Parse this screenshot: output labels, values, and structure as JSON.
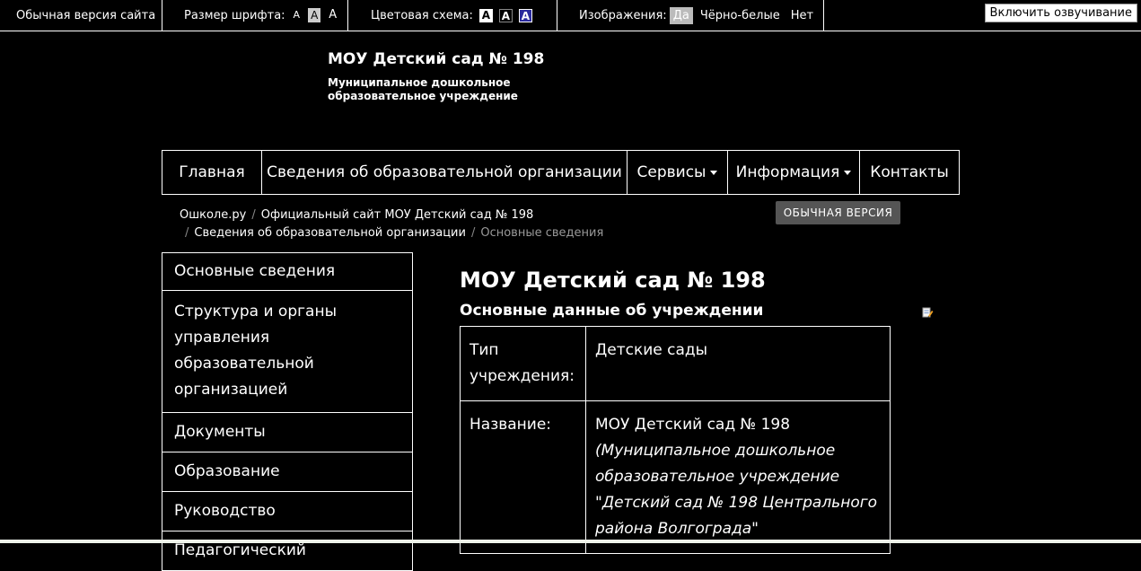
{
  "a11y": {
    "normal_version": "Обычная версия сайта",
    "font_size_label": "Размер шрифта:",
    "font_sizes": [
      "A",
      "A",
      "A"
    ],
    "color_scheme_label": "Цветовая схема:",
    "color_schemes": [
      "A",
      "A",
      "A"
    ],
    "images_label": "Изображения:",
    "images_on": "Да",
    "images_bw": "Чёрно-белые",
    "images_off": "Нет",
    "voice_button": "Включить озвучивание"
  },
  "header": {
    "title": "МОУ Детский сад № 198",
    "subtitle": "Муниципальное дошкольное образовательное учреждение"
  },
  "nav": {
    "items": [
      "Главная",
      "Сведения об образовательной организации",
      "Сервисы",
      "Информация",
      "Контакты"
    ]
  },
  "breadcrumbs": {
    "items": [
      "Ошколе.ру",
      "Официальный сайт МОУ Детский сад № 198",
      "Сведения об образовательной организации"
    ],
    "current": "Основные сведения"
  },
  "normal_version_button": "ОБЫЧНАЯ ВЕРСИЯ",
  "sidebar": {
    "items": [
      "Основные сведения",
      "Структура и органы управления образовательной организацией",
      "Документы",
      "Образование",
      "Руководство",
      "Педагогический"
    ]
  },
  "main": {
    "title": "МОУ Детский сад № 198",
    "subtitle": "Основные данные об учреждении",
    "rows": [
      {
        "label": "Тип учреждения:",
        "value": "Детские сады"
      },
      {
        "label": "Название:",
        "value": "МОУ Детский сад № 198",
        "value_italic": "(Муниципальное дошкольное образовательное учреждение \"Детский сад № 198 Центрального района Волгограда\""
      }
    ]
  },
  "colors": {
    "background": "#000000",
    "text": "#ffffff",
    "muted": "#999999",
    "button_gray": "#555555"
  }
}
